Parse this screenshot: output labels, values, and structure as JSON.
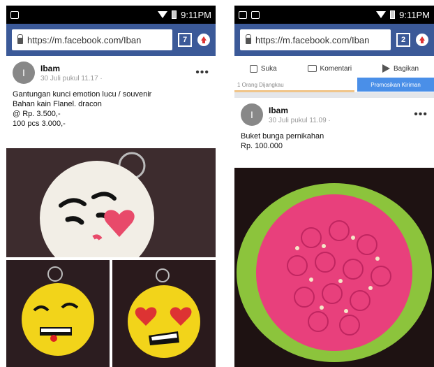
{
  "left": {
    "status": {
      "time": "9:11PM"
    },
    "browser": {
      "url": "https://m.facebook.com/Iban",
      "tab_count": "7"
    },
    "post": {
      "author": "Ibam",
      "avatar_initial": "I",
      "date": "30 Juli pukul 11.17 · ",
      "caption_lines": [
        "Gantungan kunci emotion lucu / souvenir",
        "Bahan kain Flanel. dracon",
        "@ Rp. 3.500,-",
        "100 pcs 3.000,-"
      ]
    }
  },
  "right": {
    "status": {
      "time": "9:11PM"
    },
    "browser": {
      "url": "https://m.facebook.com/Iban",
      "tab_count": "2"
    },
    "actions": {
      "like": "Suka",
      "comment": "Komentari",
      "share": "Bagikan"
    },
    "reach": {
      "text": "1 Orang Dijangkau",
      "fraction": 0.6
    },
    "promote_label": "Promosikan Kiriman",
    "post": {
      "author": "Ibam",
      "avatar_initial": "I",
      "date": "30 Juli pukul 11.09 · ",
      "caption_lines": [
        "Buket bunga pernikahan",
        "Rp. 100.000"
      ]
    }
  },
  "colors": {
    "facebook_blue": "#3b5998",
    "promote_blue": "#4a8fe8",
    "reach_bar": "#f0c58a"
  }
}
